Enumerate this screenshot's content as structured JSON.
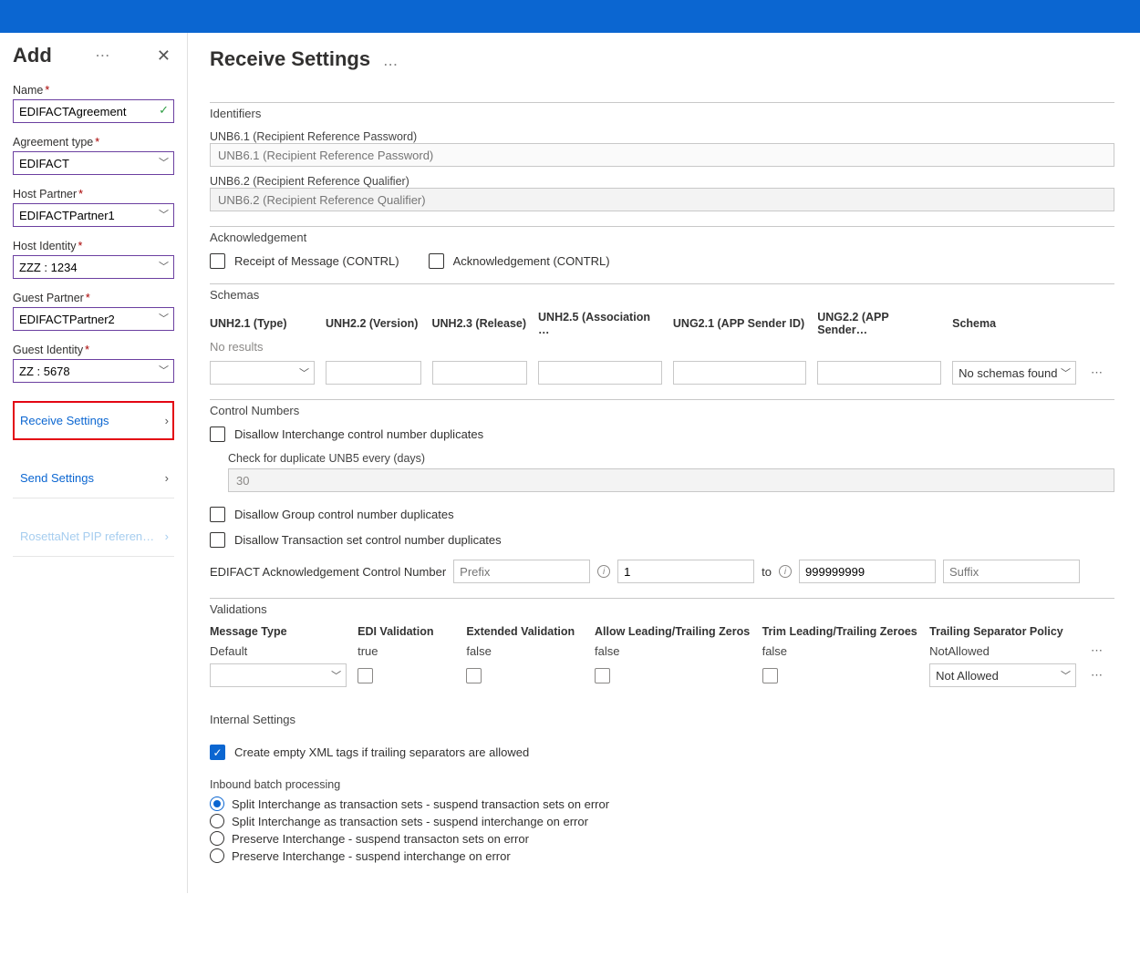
{
  "add": {
    "title": "Add",
    "name_label": "Name",
    "name_value": "EDIFACTAgreement",
    "agreement_type_label": "Agreement type",
    "agreement_type_value": "EDIFACT",
    "host_partner_label": "Host Partner",
    "host_partner_value": "EDIFACTPartner1",
    "host_identity_label": "Host Identity",
    "host_identity_value": "ZZZ : 1234",
    "guest_partner_label": "Guest Partner",
    "guest_partner_value": "EDIFACTPartner2",
    "guest_identity_label": "Guest Identity",
    "guest_identity_value": "ZZ : 5678",
    "receive_settings": "Receive Settings",
    "send_settings": "Send Settings",
    "rosettanet": "RosettaNet PIP referen…"
  },
  "main": {
    "title": "Receive Settings",
    "identifiers": {
      "title": "Identifiers",
      "unb61_label": "UNB6.1 (Recipient Reference Password)",
      "unb61_ph": "UNB6.1 (Recipient Reference Password)",
      "unb62_label": "UNB6.2 (Recipient Reference Qualifier)",
      "unb62_ph": "UNB6.2 (Recipient Reference Qualifier)"
    },
    "ack": {
      "title": "Acknowledgement",
      "receipt": "Receipt of Message (CONTRL)",
      "ack": "Acknowledgement (CONTRL)"
    },
    "schemas": {
      "title": "Schemas",
      "headers": [
        "UNH2.1 (Type)",
        "UNH2.2 (Version)",
        "UNH2.3 (Release)",
        "UNH2.5 (Association …",
        "UNG2.1 (APP Sender ID)",
        "UNG2.2 (APP Sender…",
        "Schema"
      ],
      "no_results": "No results",
      "no_schemas": "No schemas found"
    },
    "control": {
      "title": "Control Numbers",
      "disallow_interchange": "Disallow Interchange control number duplicates",
      "check_label": "Check for duplicate UNB5 every (days)",
      "check_value": "30",
      "disallow_group": "Disallow Group control number duplicates",
      "disallow_tx": "Disallow Transaction set control number duplicates",
      "ack_ctrl_label": "EDIFACT Acknowledgement Control Number",
      "prefix_ph": "Prefix",
      "from_value": "1",
      "to_label": "to",
      "to_value": "999999999",
      "suffix_ph": "Suffix"
    },
    "validations": {
      "title": "Validations",
      "headers": [
        "Message Type",
        "EDI Validation",
        "Extended Validation",
        "Allow Leading/Trailing Zeros",
        "Trim Leading/Trailing Zeroes",
        "Trailing Separator Policy"
      ],
      "row": {
        "type": "Default",
        "edi": "true",
        "ext": "false",
        "allow": "false",
        "trim": "false",
        "policy": "NotAllowed"
      },
      "policy_sel": "Not Allowed"
    },
    "internal": {
      "title": "Internal Settings",
      "create_empty": "Create empty XML tags if trailing separators are allowed",
      "batch_label": "Inbound batch processing",
      "opts": [
        "Split Interchange as transaction sets - suspend transaction sets on error",
        "Split Interchange as transaction sets - suspend interchange on error",
        "Preserve Interchange - suspend transacton sets on error",
        "Preserve Interchange - suspend interchange on error"
      ]
    }
  }
}
